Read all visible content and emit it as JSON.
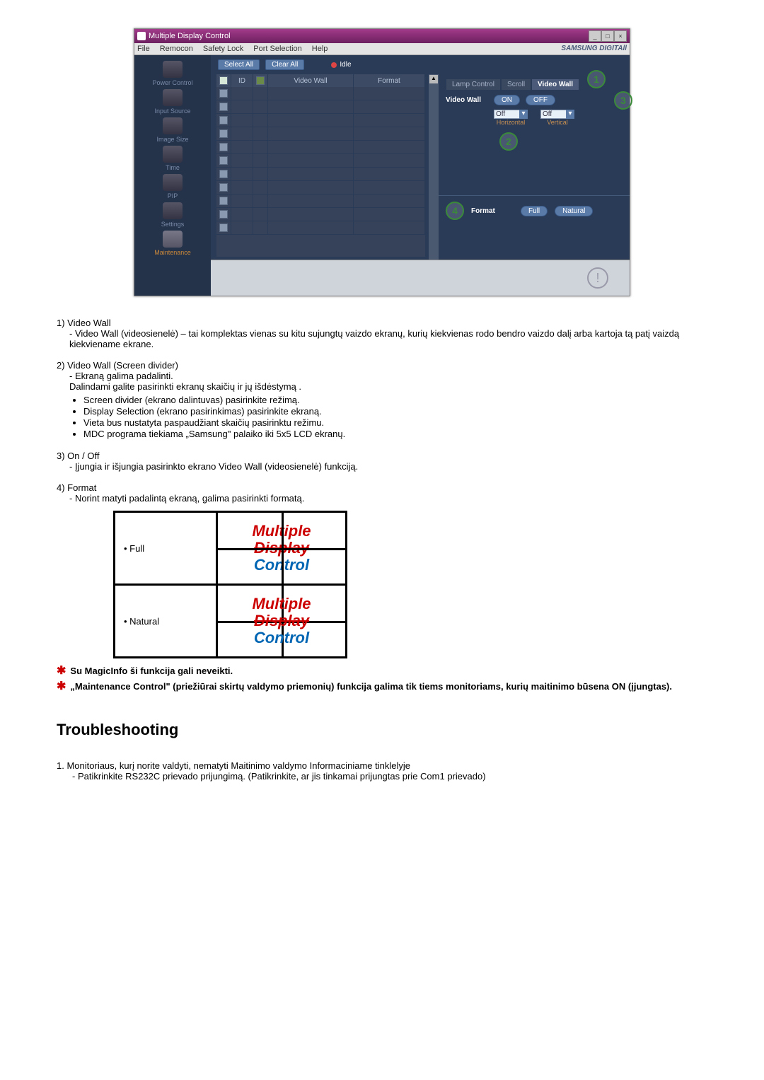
{
  "app": {
    "title": "Multiple Display Control",
    "menubar": [
      "File",
      "Remocon",
      "Safety Lock",
      "Port Selection",
      "Help"
    ],
    "brand": "SAMSUNG DIGITAll"
  },
  "sidebar": {
    "items": [
      {
        "label": "Power Control"
      },
      {
        "label": "Input Source"
      },
      {
        "label": "Image Size"
      },
      {
        "label": "Time"
      },
      {
        "label": "PIP"
      },
      {
        "label": "Settings"
      },
      {
        "label": "Maintenance"
      }
    ]
  },
  "toolbar": {
    "select_all": "Select All",
    "clear_all": "Clear All",
    "idle": "Idle"
  },
  "table": {
    "headers": {
      "cb": "",
      "id": "ID",
      "icon": "",
      "video_wall": "Video Wall",
      "format": "Format"
    },
    "row_count": 11
  },
  "right": {
    "tabs": [
      "Lamp Control",
      "Scroll",
      "Video Wall"
    ],
    "active_tab": 2,
    "video_wall_label": "Video Wall",
    "on": "ON",
    "off": "OFF",
    "horiz_value": "Off",
    "vert_value": "Off",
    "horiz_label": "Horizontal",
    "vert_label": "Vertical",
    "format_label": "Format",
    "full": "Full",
    "natural": "Natural"
  },
  "callouts": {
    "c1": "1",
    "c2": "2",
    "c3": "3",
    "c4": "4"
  },
  "doc": {
    "item1_title": "1)  Video Wall",
    "item1_body": "- Video Wall (videosienelė) – tai komplektas vienas su kitu sujungtų vaizdo ekranų, kurių kiekvienas rodo bendro vaizdo dalį arba kartoja tą patį vaizdą kiekviename ekrane.",
    "item2_title": "2)  Video Wall (Screen divider)",
    "item2_l1": "- Ekraną galima padalinti.",
    "item2_l2": "Dalindami galite pasirinkti ekranų skaičių ir jų išdėstymą .",
    "item2_b1": "Screen divider (ekrano dalintuvas) pasirinkite režimą.",
    "item2_b2": "Display Selection (ekrano pasirinkimas) pasirinkite ekraną.",
    "item2_b3": "Vieta bus nustatyta paspaudžiant skaičių pasirinktu režimu.",
    "item2_b4": "MDC programa tiekiama „Samsung\" palaiko iki 5x5 LCD ekranų.",
    "item3_title": "3)  On / Off",
    "item3_body": "- Įjungia ir išjungia pasirinkto ekrano Video Wall (videosienelė) funkciją.",
    "item4_title": "4)  Format",
    "item4_body": "- Norint matyti padalintą ekraną, galima pasirinkti formatą.",
    "fmt_full": "Full",
    "fmt_natural": "Natural",
    "mdc_l1": "Multiple",
    "mdc_l2": "Display",
    "mdc_l3": "Control",
    "note1": "Su MagicInfo ši funkcija gali neveikti.",
    "note2": "„Maintenance Control\" (priežiūrai skirtų valdymo priemonių) funkcija galima tik tiems monitoriams, kurių maitinimo būsena ON (įjungtas).",
    "ts_heading": "Troubleshooting",
    "ts1": "Monitoriaus, kurį norite valdyti, nematyti Maitinimo valdymo Informaciniame tinklelyje",
    "ts1_sub": "- Patikrinkite RS232C prievado prijungimą. (Patikrinkite, ar jis tinkamai prijungtas prie Com1 prievado)"
  }
}
